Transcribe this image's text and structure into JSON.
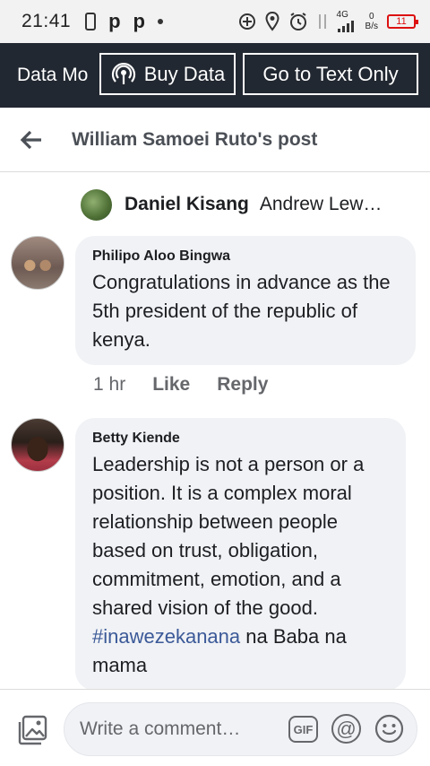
{
  "status_bar": {
    "time": "21:41",
    "network_type": "4G",
    "speed_value": "0",
    "speed_unit": "B/s",
    "battery": "11"
  },
  "data_bar": {
    "data_mode_label": "Data Mo",
    "buy_data_label": "Buy Data",
    "text_only_label": "Go to Text Only"
  },
  "header": {
    "title": "William Samoei Ruto's post"
  },
  "tagged": {
    "name": "Daniel Kisang",
    "others": "Andrew Lew…"
  },
  "comments": [
    {
      "author": "Philipo Aloo Bingwa",
      "text": "Congratulations in advance as the 5th president of the republic of kenya.",
      "time": "1 hr",
      "like_label": "Like",
      "reply_label": "Reply"
    },
    {
      "author": "Betty Kiende",
      "text": "Leadership is not a person or a position. It is a complex moral relationship between people based on trust, obligation, commitment, emotion, and a shared vision of the good. ",
      "hashtag": "#inawezekanana",
      "text_after": " na Baba na mama"
    }
  ],
  "composer": {
    "placeholder": "Write a comment…",
    "gif_label": "GIF",
    "at_label": "@"
  },
  "colors": {
    "data_bar_bg": "#222831",
    "bubble_bg": "#f0f2f5",
    "hashtag": "#3b5998",
    "battery_low": "#dd1111"
  }
}
